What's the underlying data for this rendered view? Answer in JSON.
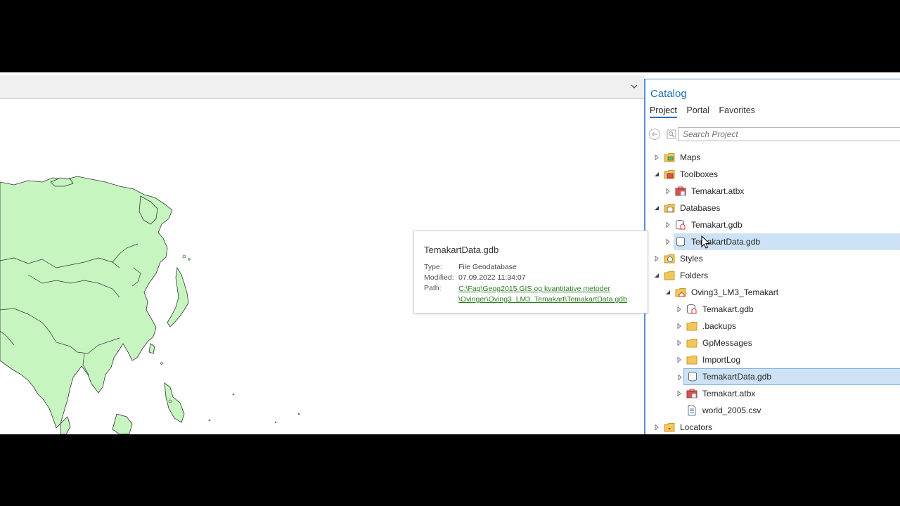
{
  "catalog": {
    "title": "Catalog",
    "tabs": [
      {
        "label": "Project",
        "active": true
      },
      {
        "label": "Portal",
        "active": false
      },
      {
        "label": "Favorites",
        "active": false
      }
    ],
    "search_placeholder": "Search Project",
    "tree": {
      "maps": "Maps",
      "toolboxes": "Toolboxes",
      "toolbox_item": "Temakart.atbx",
      "databases": "Databases",
      "db1": "Temakart.gdb",
      "db2": "TemakartData.gdb",
      "styles": "Styles",
      "folders": "Folders",
      "folder": "Oving3_LM3_Temakart",
      "f_gdb1": "Temakart.gdb",
      "f_backups": ".backups",
      "f_gpmessages": "GpMessages",
      "f_importlog": "ImportLog",
      "f_gdb2": "TemakartData.gdb",
      "f_atbx": "Temakart.atbx",
      "f_csv": "world_2005.csv",
      "locators": "Locators"
    }
  },
  "tooltip": {
    "title": "TemakartData.gdb",
    "type_label": "Type:",
    "type_value": "File Geodatabase",
    "modified_label": "Modified:",
    "modified_value": "07.09.2022 11:34:07",
    "path_label": "Path:",
    "path_line1": "C:\\Fag\\Geog2015 GIS og kvantitative metoder",
    "path_line2": "\\Ovinger\\Oving3_LM3_Temakart\\TemakartData.gdb"
  },
  "colors": {
    "land": "#c6f5c0",
    "accent": "#1d6fb8",
    "selection": "#cde3f5",
    "link": "#2e7d1f"
  }
}
